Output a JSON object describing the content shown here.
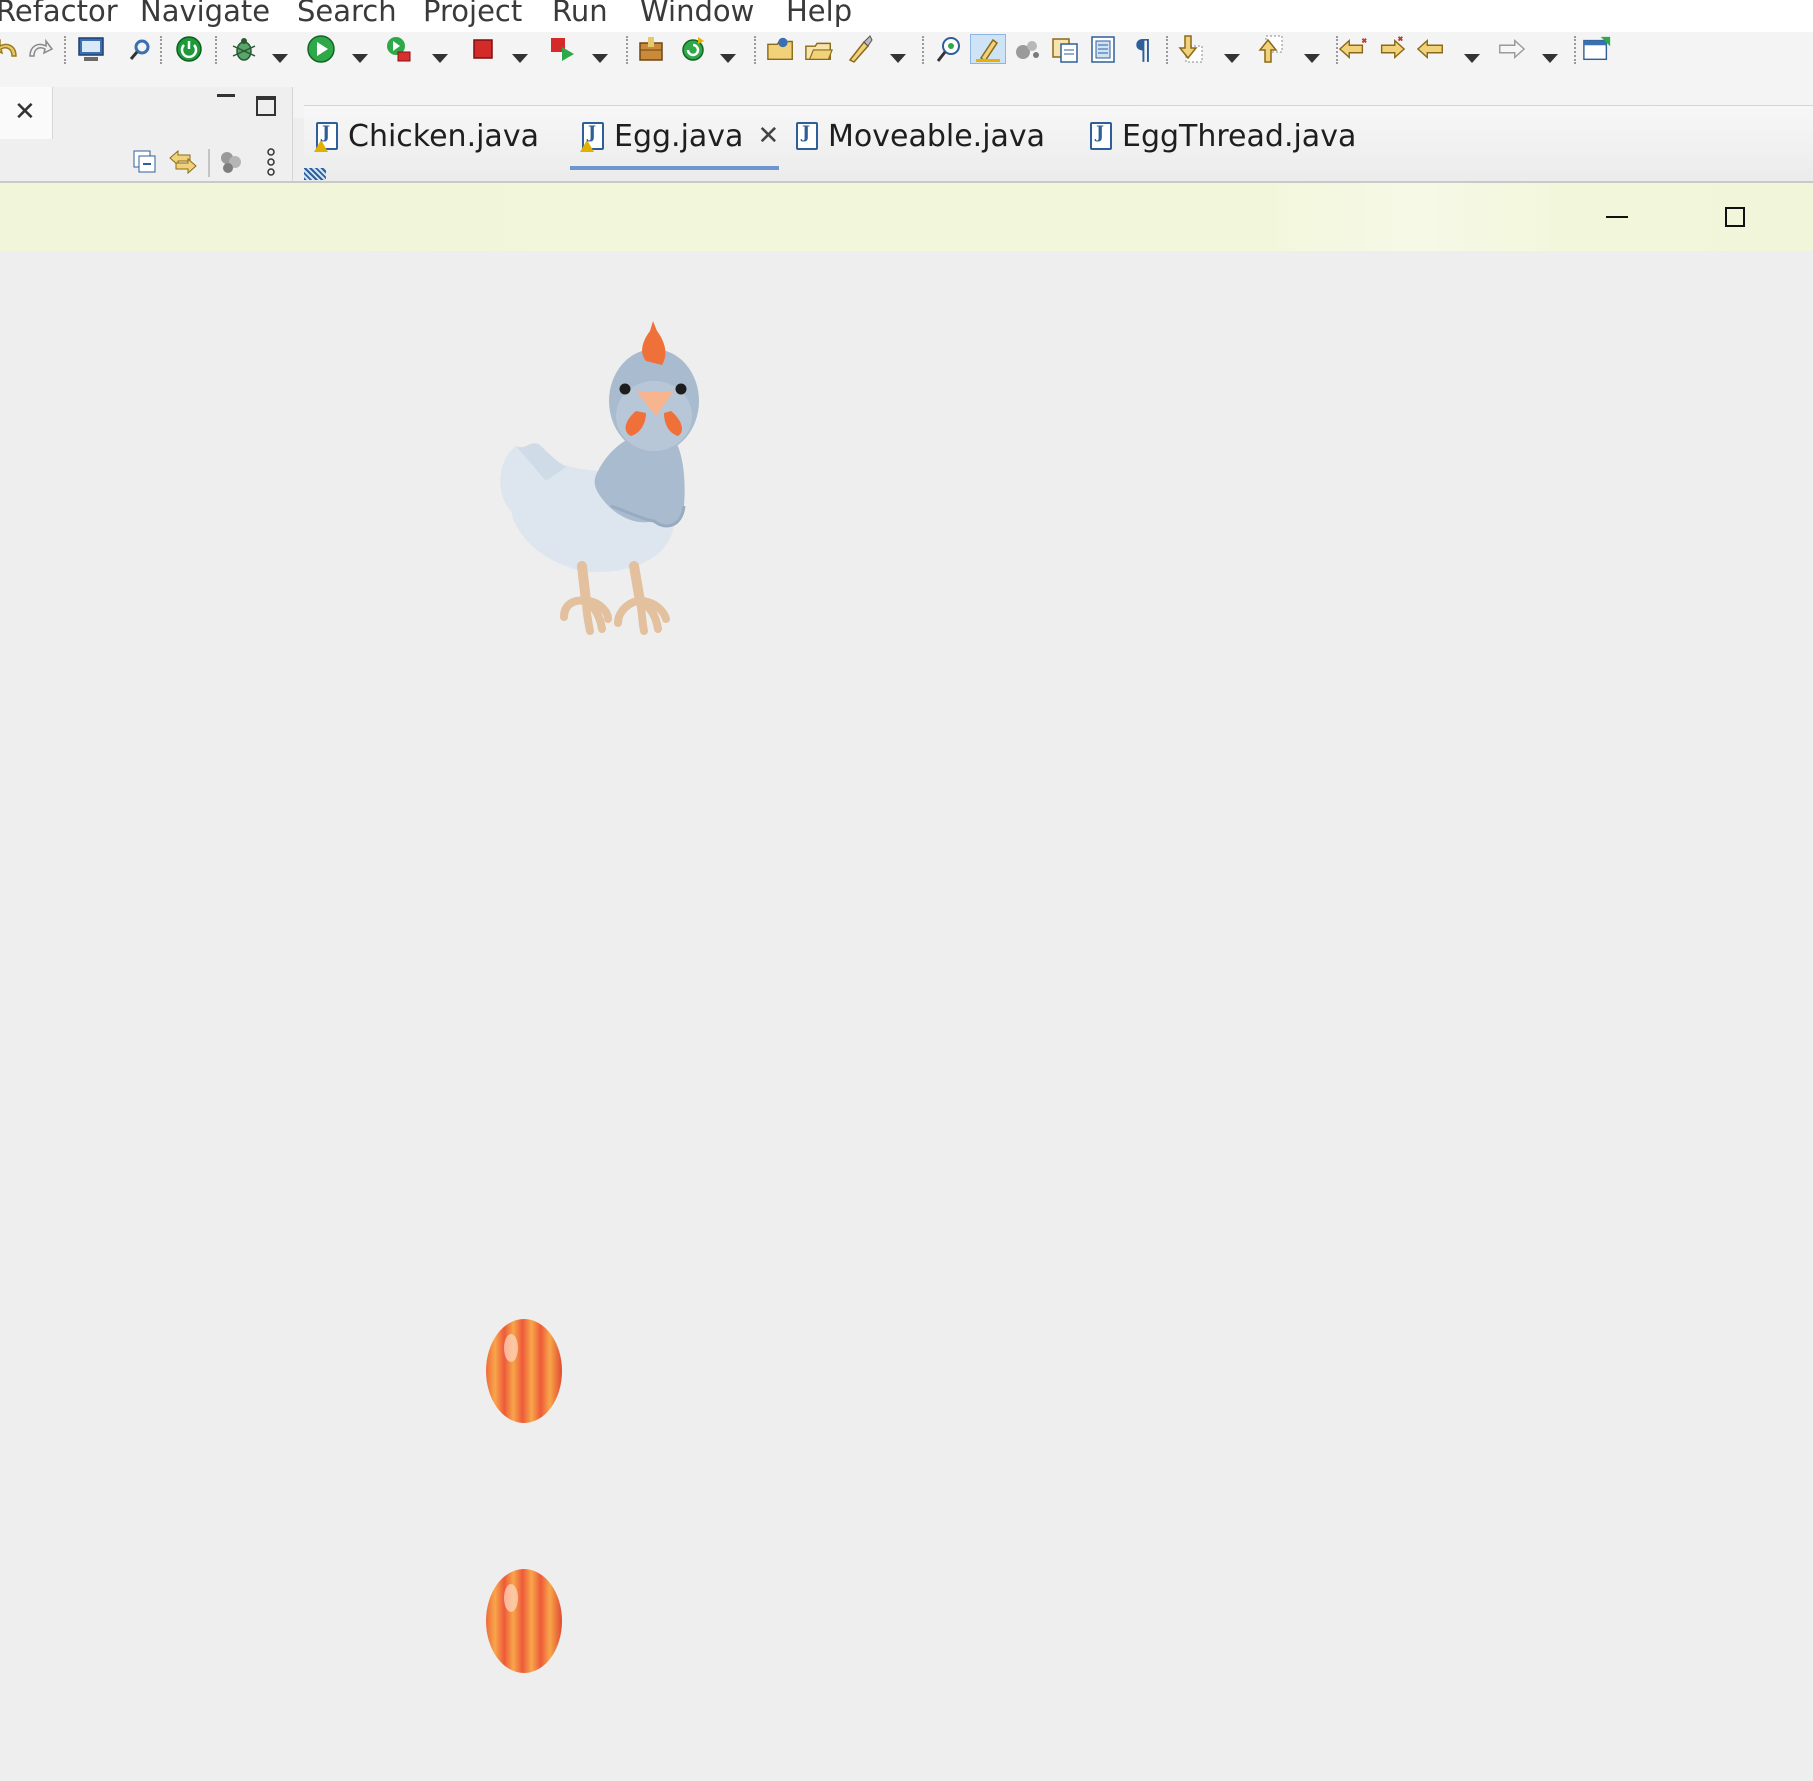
{
  "menu": {
    "items": [
      "Refactor",
      "Navigate",
      "Search",
      "Project",
      "Run",
      "Window",
      "Help"
    ]
  },
  "toolbar": {
    "icons": [
      "undo-icon",
      "redo-icon",
      "terminal-icon",
      "search-tool-icon",
      "power-icon",
      "debug-icon",
      "run-icon",
      "run-config-icon",
      "stop-icon",
      "launch-icon",
      "package-icon",
      "refresh-icon",
      "open-folder-icon",
      "open-icon",
      "brush-icon",
      "annotation-icon",
      "highlight-icon",
      "palette-icon",
      "copy-icon",
      "list-icon",
      "pilcrow-icon",
      "next-annotation-icon",
      "prev-annotation-icon",
      "back-edit-icon",
      "forward-edit-icon",
      "back-icon",
      "forward-icon",
      "new-window-icon"
    ]
  },
  "editor": {
    "tabs": [
      {
        "label": "Chicken.java",
        "active": false,
        "warning": true
      },
      {
        "label": "Egg.java",
        "active": true,
        "warning": true
      },
      {
        "label": "Moveable.java",
        "active": false,
        "warning": false
      },
      {
        "label": "EggThread.java",
        "active": false,
        "warning": false
      }
    ]
  },
  "app_window": {
    "title": "",
    "sprites": {
      "chicken": "chicken-sprite",
      "eggs": [
        "egg-sprite",
        "egg-sprite"
      ]
    }
  },
  "colors": {
    "titlebar": "#f1f6da",
    "canvas": "#eeeeee",
    "tab_accent": "#6f95cf",
    "chicken_body": "#d6e1ec",
    "chicken_wing": "#a9bbce",
    "comb": "#f0703a",
    "egg": "#f06a3c"
  }
}
